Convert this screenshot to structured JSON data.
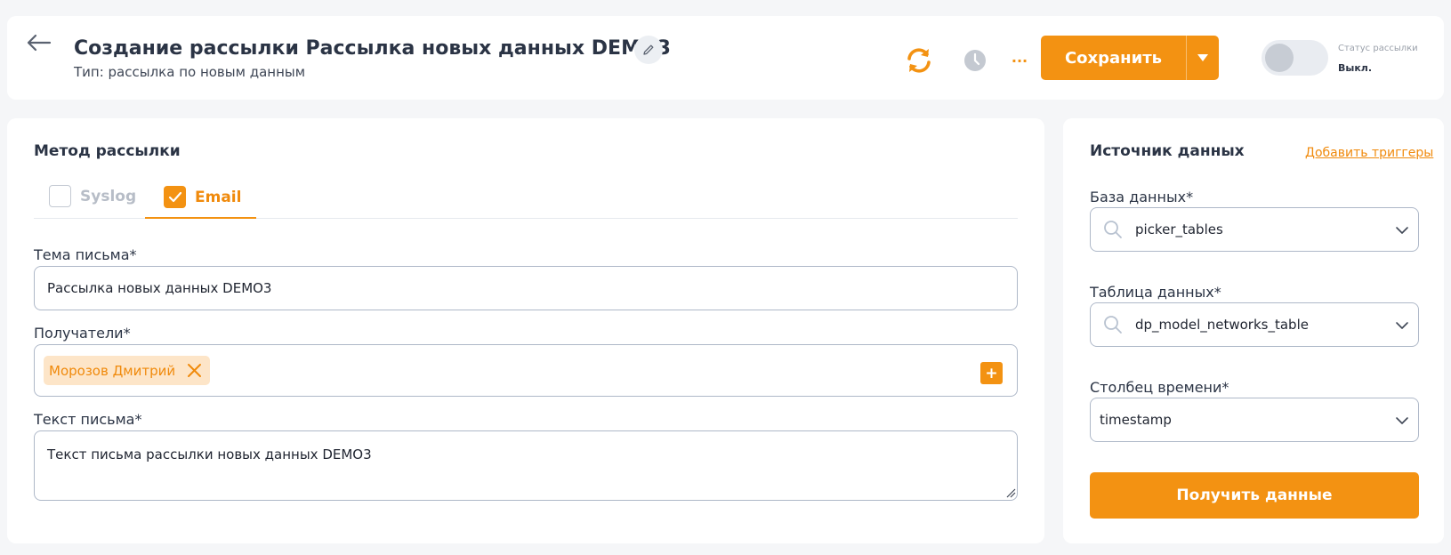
{
  "header": {
    "title": "Создание рассылки Рассылка новых данных DEMO3",
    "subtitle": "Тип: рассылка по новым данным",
    "save_label": "Сохранить",
    "status_label": "Статус рассылки",
    "status_value": "Выкл.",
    "more_label": "···",
    "status_enabled": false
  },
  "method": {
    "title": "Метод рассылки",
    "tabs": [
      {
        "label": "Syslog",
        "checked": false
      },
      {
        "label": "Email",
        "checked": true
      }
    ]
  },
  "email": {
    "subject_label": "Тема письма*",
    "subject_value": "Рассылка новых данных DEMO3",
    "recipients_label": "Получатели*",
    "recipients": [
      "Морозов Дмитрий"
    ],
    "add_label": "+",
    "body_label": "Текст письма*",
    "body_value": "Текст письма рассылки новых данных DEMO3"
  },
  "source": {
    "title": "Источник данных",
    "triggers_link": "Добавить триггеры",
    "db_label": "База данных*",
    "db_value": "picker_tables",
    "table_label": "Таблица данных*",
    "table_value": "dp_model_networks_table",
    "time_label": "Столбец времени*",
    "time_value": "timestamp",
    "get_button": "Получить данные"
  },
  "colors": {
    "accent": "#f39212",
    "background": "#f5f6f8",
    "text": "#2b3445"
  }
}
